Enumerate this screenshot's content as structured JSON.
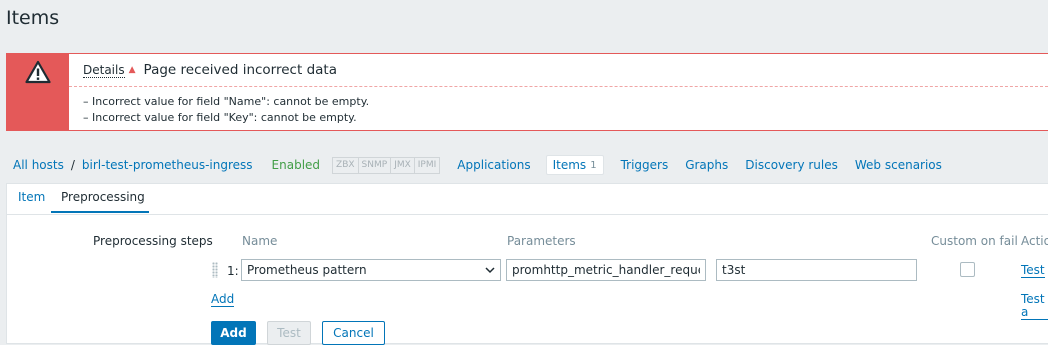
{
  "page": {
    "title": "Items"
  },
  "message": {
    "details_label": "Details",
    "title": "Page received incorrect data",
    "errors": [
      "–  Incorrect value for field \"Name\": cannot be empty.",
      "–  Incorrect value for field \"Key\": cannot be empty."
    ],
    "icon": "warning-icon",
    "color": "#e45959"
  },
  "nav": {
    "all_hosts": "All hosts",
    "separator": "/",
    "host": "birl-test-prometheus-ingress",
    "status": "Enabled",
    "availability": [
      "ZBX",
      "SNMP",
      "JMX",
      "IPMI"
    ],
    "applications": "Applications",
    "items_label": "Items",
    "items_count": "1",
    "triggers": "Triggers",
    "graphs": "Graphs",
    "discovery_rules": "Discovery rules",
    "web_scenarios": "Web scenarios"
  },
  "tabs": {
    "item": "Item",
    "preprocessing": "Preprocessing"
  },
  "preprocessing": {
    "section_label": "Preprocessing steps",
    "col_name": "Name",
    "col_parameters": "Parameters",
    "col_custom_on_fail": "Custom on fail",
    "col_actions": "Actio",
    "step": {
      "number": "1:",
      "name": "Prometheus pattern",
      "param1": "promhttp_metric_handler_requests_",
      "param2": "t3st",
      "custom_on_fail": false,
      "test_label": "Test"
    },
    "add_label": "Add",
    "test_all_label": "Test a"
  },
  "buttons": {
    "add": "Add",
    "test": "Test",
    "cancel": "Cancel"
  },
  "colors": {
    "accent": "#0275b8",
    "error": "#e45959",
    "enabled": "#429e47"
  }
}
